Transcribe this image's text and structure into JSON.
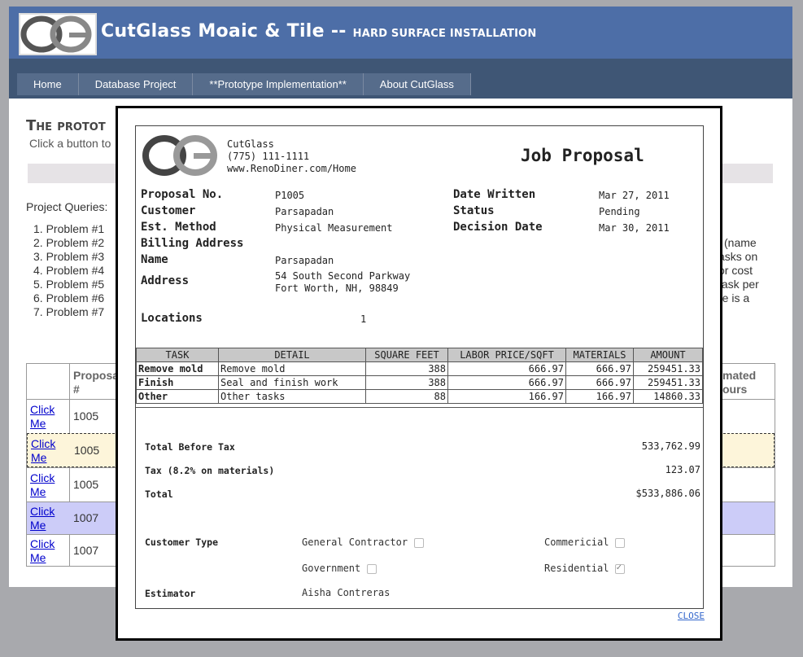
{
  "site": {
    "title": "CutGlass Moaic & Tile --",
    "subtitle": "Hard surface installation",
    "logo_text": "CG"
  },
  "nav": {
    "items": [
      "Home",
      "Database Project",
      "**Prototype Implementation**",
      "About CutGlass"
    ]
  },
  "background": {
    "page_title": "The protot",
    "page_sub": "Click a button to",
    "queries_label": "Project Queries:",
    "queries": [
      "1. Problem #1",
      "2. Problem #2",
      "3. Problem #3",
      "4. Problem #4",
      "5. Problem #5",
      "6. Problem #6",
      "7. Problem #7"
    ],
    "right_text": [
      "l (name",
      "asks on",
      "or cost",
      "task per",
      "re is a"
    ],
    "table_header_left": "Proposa\n#",
    "table_header_right": "mated\nours",
    "rows": [
      {
        "link": "Click Me",
        "num": "1005",
        "highlight": "none"
      },
      {
        "link": "Click Me",
        "num": "1005",
        "highlight": "#fdf5da"
      },
      {
        "link": "Click Me",
        "num": "1005",
        "highlight": "none"
      },
      {
        "link": "Click Me",
        "num": "1007",
        "highlight": "#ccccf8"
      },
      {
        "link": "Click Me",
        "num": "1007",
        "highlight": "none"
      }
    ]
  },
  "proposal": {
    "company": {
      "name": "CutGlass",
      "phone": "(775) 111-1111",
      "url": "www.RenoDiner.com/Home"
    },
    "title": "Job Proposal",
    "fields": {
      "proposal_no_label": "Proposal No.",
      "proposal_no": "P1005",
      "customer_label": "Customer",
      "customer": "Parsapadan",
      "est_method_label": "Est. Method",
      "est_method": "Physical Measurement",
      "billing_label": "Billing Address",
      "name_label": "Name",
      "name": "Parsapadan",
      "address_label": "Address",
      "address_line1": "54 South Second Parkway",
      "address_line2": "Fort Worth, NH, 98849",
      "date_written_label": "Date Written",
      "date_written": "Mar 27, 2011",
      "status_label": "Status",
      "status": "Pending",
      "decision_date_label": "Decision Date",
      "decision_date": "Mar 30, 2011",
      "locations_label": "Locations",
      "locations": "1"
    },
    "table": {
      "headers": [
        "TASK",
        "DETAIL",
        "SQUARE FEET",
        "LABOR PRICE/SQFT",
        "MATERIALS",
        "AMOUNT"
      ],
      "rows": [
        [
          "Remove mold",
          "Remove mold",
          "388",
          "666.97",
          "666.97",
          "259451.33"
        ],
        [
          "Finish",
          "Seal and finish work",
          "388",
          "666.97",
          "666.97",
          "259451.33"
        ],
        [
          "Other",
          "Other tasks",
          "88",
          "166.97",
          "166.97",
          "14860.33"
        ]
      ]
    },
    "totals": {
      "before_tax_label": "Total Before Tax",
      "before_tax": "533,762.99",
      "tax_label": "Tax (8.2% on materials)",
      "tax": "123.07",
      "total_label": "Total",
      "total": "$533,886.06"
    },
    "customer_type": {
      "label": "Customer Type",
      "options": [
        {
          "label": "General Contractor",
          "checked": false
        },
        {
          "label": "Commericial",
          "checked": false
        },
        {
          "label": "Government",
          "checked": false
        },
        {
          "label": "Residential",
          "checked": true
        }
      ]
    },
    "estimator_label": "Estimator",
    "estimator": "Aisha Contreras"
  },
  "modal": {
    "close_label": "CLOSE"
  }
}
